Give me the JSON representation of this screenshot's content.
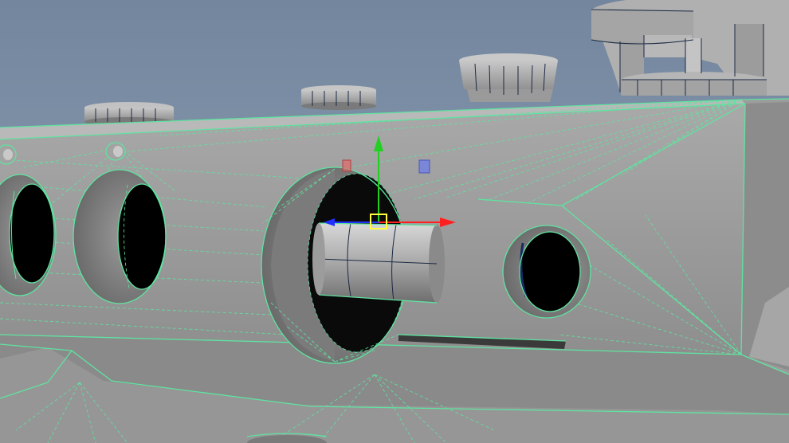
{
  "viewport": {
    "background_top": "#74879f",
    "background_bottom": "#93a2b5",
    "mesh_color": "#b3b3b3",
    "mesh_shadow": "#8f8f8f",
    "selection_wire_color": "#5fe3a0",
    "hole_color": "#000000"
  },
  "manipulator": {
    "tool": "move-tool",
    "x_axis_color": "#ff2020",
    "y_axis_color": "#22d022",
    "z_axis_color": "#2030ff",
    "center_handle_color": "#ffff40",
    "xy_plane_color": "#7a86d8",
    "yz_plane_color": "#e06a6a"
  }
}
